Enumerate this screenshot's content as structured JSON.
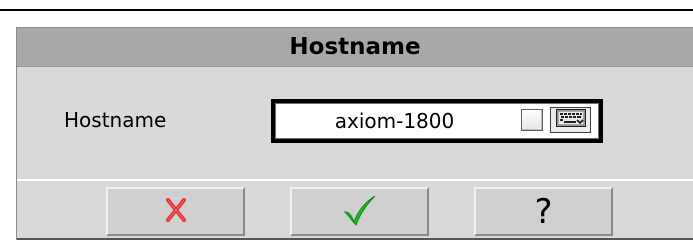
{
  "dialog": {
    "title": "Hostname",
    "field": {
      "label": "Hostname",
      "value": "axiom-1800"
    },
    "checkbox": {
      "checked": false
    },
    "icons": {
      "keyboard": "keyboard-icon",
      "cancel": "cross-icon",
      "ok": "checkmark-icon"
    },
    "buttons": {
      "help_label": "?"
    },
    "colors": {
      "title_bar": "#a8a8a8",
      "panel": "#d9d9d9",
      "cancel": "#e03030",
      "ok": "#22bb22"
    }
  }
}
